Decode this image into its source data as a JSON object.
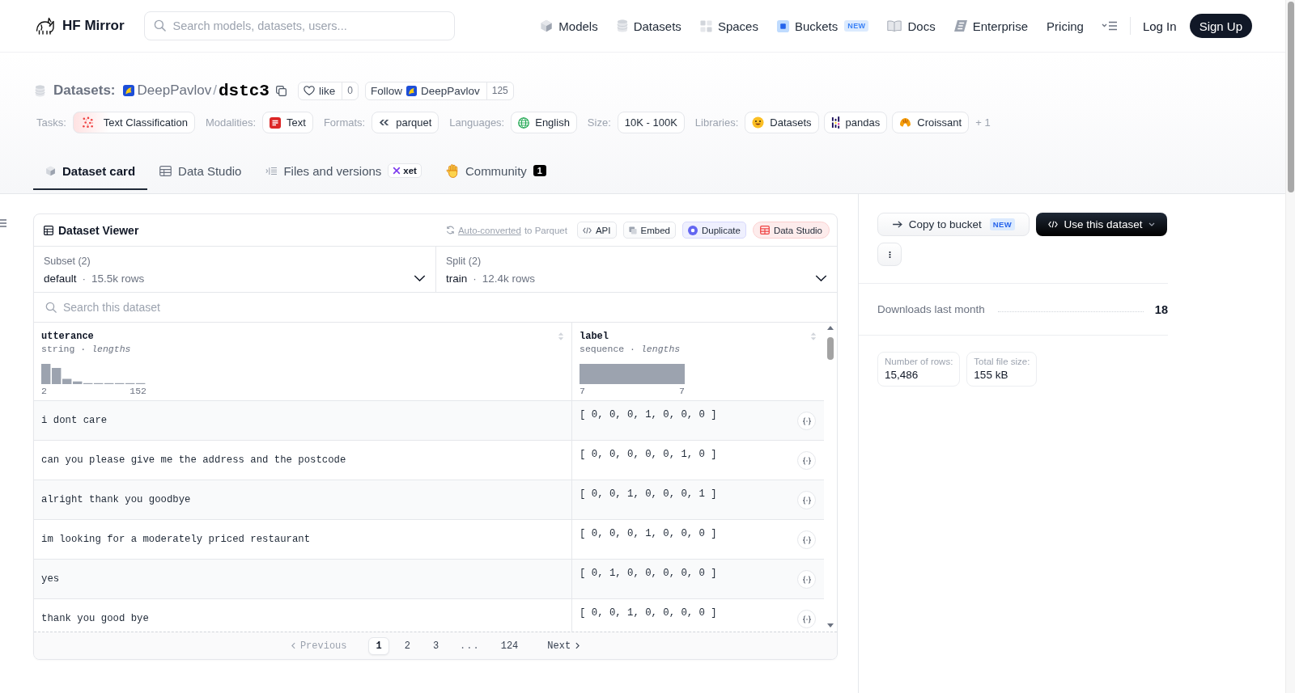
{
  "nav": {
    "brand": "HF Mirror",
    "search": {
      "placeholder": "Search models, datasets, users..."
    },
    "items": [
      {
        "label": "Models"
      },
      {
        "label": "Datasets"
      },
      {
        "label": "Spaces"
      },
      {
        "label": "Buckets",
        "badge": "NEW"
      },
      {
        "label": "Docs"
      },
      {
        "label": "Enterprise"
      },
      {
        "label": "Pricing"
      }
    ],
    "login": "Log In",
    "signup": "Sign Up"
  },
  "repo": {
    "type": "Datasets:",
    "owner": "DeepPavlov",
    "separator": "/",
    "name": "dstc3",
    "like": {
      "label": "like",
      "count": "0"
    },
    "follow": {
      "label": "Follow",
      "owner": "DeepPavlov",
      "count": "125"
    }
  },
  "tag_groups": [
    {
      "label": "Tasks:",
      "tags": [
        "Text Classification"
      ]
    },
    {
      "label": "Modalities:",
      "tags": [
        "Text"
      ]
    },
    {
      "label": "Formats:",
      "tags": [
        "parquet"
      ]
    },
    {
      "label": "Languages:",
      "tags": [
        "English"
      ]
    },
    {
      "label": "Size:",
      "tags": [
        "10K - 100K"
      ]
    },
    {
      "label": "Libraries:",
      "tags": [
        "Datasets",
        "pandas",
        "Croissant"
      ],
      "more": "+ 1"
    }
  ],
  "tabs": [
    {
      "label": "Dataset card",
      "selected": true
    },
    {
      "label": "Data Studio",
      "selected": false
    },
    {
      "label": "Files and versions",
      "selected": false,
      "badge": "xet"
    },
    {
      "label": "Community",
      "selected": false,
      "count": "1"
    }
  ],
  "viewer": {
    "title": "Dataset Viewer",
    "conversion": {
      "link": "Auto-converted",
      "text": "to Parquet"
    },
    "actions": [
      {
        "label": "API"
      },
      {
        "label": "Embed"
      },
      {
        "label": "Duplicate",
        "color": "#6366f1"
      },
      {
        "label": "Data Studio",
        "color": "#ef4444"
      }
    ],
    "subset": {
      "label": "Subset (2)",
      "value": "default",
      "separator": "·",
      "detail": "15.5k rows"
    },
    "split": {
      "label": "Split (2)",
      "value": "train",
      "separator": "·",
      "detail": "12.4k rows"
    },
    "search": {
      "placeholder": "Search this dataset"
    },
    "columns": [
      {
        "name": "utterance",
        "summary": "string · *lengths*",
        "min": "2",
        "max": "152"
      },
      {
        "name": "label",
        "summary": "sequence · *lengths*",
        "min": "7",
        "max": "7"
      }
    ],
    "rows": [
      {
        "cells": [
          "i dont care",
          "[ 0, 0, 0, 1, 0, 0, 0 ]"
        ]
      },
      {
        "cells": [
          "can you please give me the address and the postcode",
          "[ 0, 0, 0, 0, 0, 1, 0 ]"
        ]
      },
      {
        "cells": [
          "alright thank you goodbye",
          "[ 0, 0, 1, 0, 0, 0, 1 ]"
        ]
      },
      {
        "cells": [
          "im looking for a moderately priced restaurant",
          "[ 0, 0, 0, 1, 0, 0, 0 ]"
        ]
      },
      {
        "cells": [
          "yes",
          "[ 0, 1, 0, 0, 0, 0, 0 ]"
        ]
      },
      {
        "cells": [
          "thank you good bye",
          "[ 0, 0, 1, 0, 0, 0, 0 ]"
        ]
      }
    ],
    "pagination": {
      "previous": {
        "label": "Previous",
        "disabled": true
      },
      "pages": [
        {
          "label": "1",
          "kind": "page",
          "selected": true
        },
        {
          "label": "2",
          "kind": "page",
          "selected": false
        },
        {
          "label": "3",
          "kind": "page",
          "selected": false
        },
        {
          "label": "...",
          "kind": "gap",
          "selected": false
        },
        {
          "label": "124",
          "kind": "page",
          "selected": false
        }
      ],
      "next": {
        "label": "Next",
        "disabled": false
      }
    }
  },
  "sidebar": {
    "copy_button": {
      "label": "Copy to bucket",
      "badge": "NEW"
    },
    "use_button": {
      "label": "Use this dataset"
    },
    "downloads": {
      "label": "Downloads last month",
      "value": "18"
    },
    "facts": [
      {
        "label": "Number of rows:",
        "value": "15,486"
      },
      {
        "label": "Total file size:",
        "value": "155 kB"
      }
    ]
  }
}
